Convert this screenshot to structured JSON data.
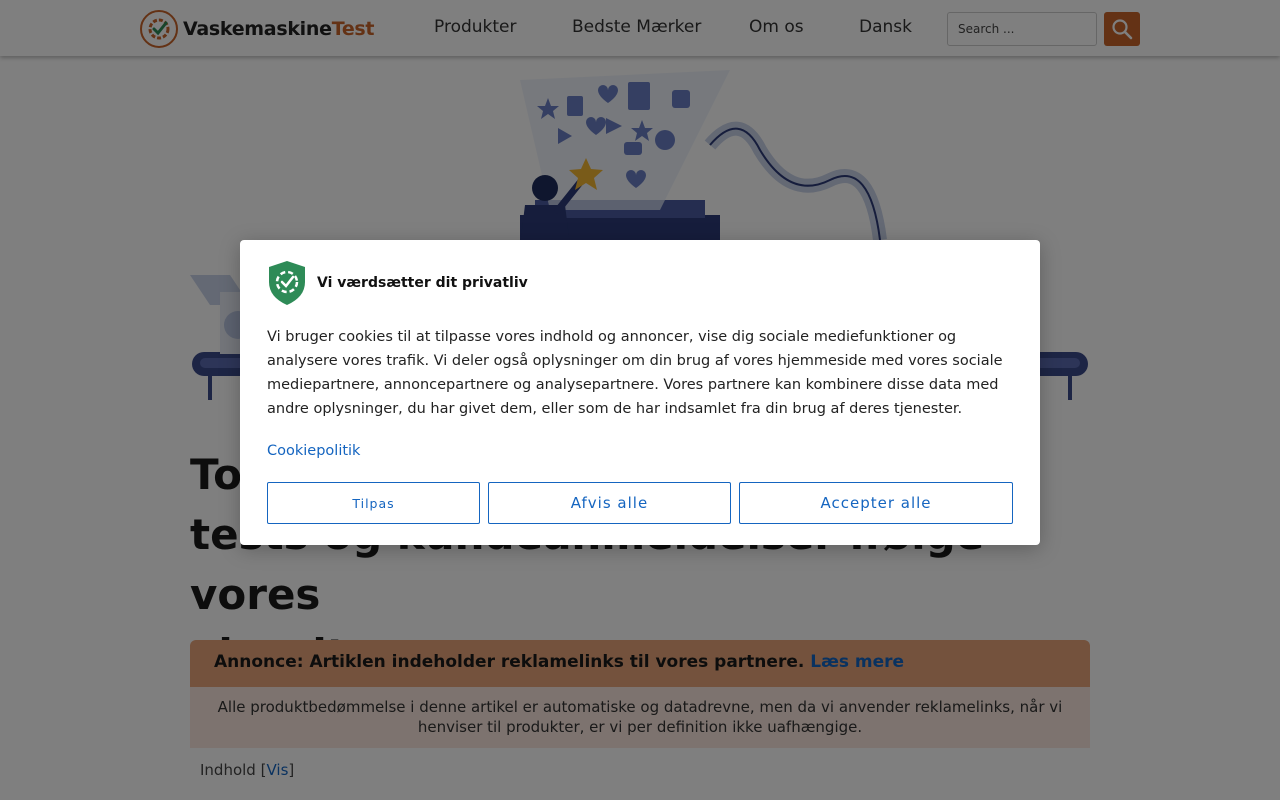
{
  "header": {
    "logo": {
      "name_main": "Vaskemaskine",
      "name_accent": "Test"
    },
    "nav": [
      "Produkter",
      "Bedste Mærker",
      "Om os",
      "Dansk"
    ],
    "search": {
      "placeholder": "Search ..."
    }
  },
  "main": {
    "title_lines": [
      "Top",
      "tests og kundeanmeldelser ifølge vores",
      "algoritme"
    ],
    "ad_banner": {
      "text": "Annonce: Artiklen indeholder reklamelinks til vores partnere.",
      "link": "Læs mere"
    },
    "ad_note": "Alle produktbedømmelse i denne artikel er automatiske og datadrevne, men da vi anvender reklamelinks, når vi henviser til produkter, er vi per definition ikke uafhængige.",
    "toc": {
      "label": "Indhold",
      "open_bracket": "[",
      "link": "Vis",
      "close_bracket": "]"
    }
  },
  "cookie_dialog": {
    "title": "Vi værdsætter dit privatliv",
    "body": "Vi bruger cookies til at tilpasse vores indhold og annoncer, vise dig sociale mediefunktioner og analysere vores trafik. Vi deler også oplysninger om din brug af vores hjemmeside med vores sociale mediepartnere, annoncepartnere og analysepartnere. Vores partnere kan kombinere disse data med andre oplysninger, du har givet dem, eller som de har indsamlet fra din brug af deres tjenester.",
    "policy_link": "Cookiepolitik",
    "buttons": {
      "customize": "Tilpas",
      "reject": "Afvis alle",
      "accept": "Accepter alle"
    }
  },
  "colors": {
    "brand": "#c8642a",
    "link": "#1565c0",
    "shield": "#2e8b57",
    "ad_banner": "#e8a57a",
    "ad_note": "#fbe7de"
  },
  "icons": {
    "logo": "gear-check-icon",
    "search": "search-icon",
    "shield": "privacy-shield-icon"
  }
}
